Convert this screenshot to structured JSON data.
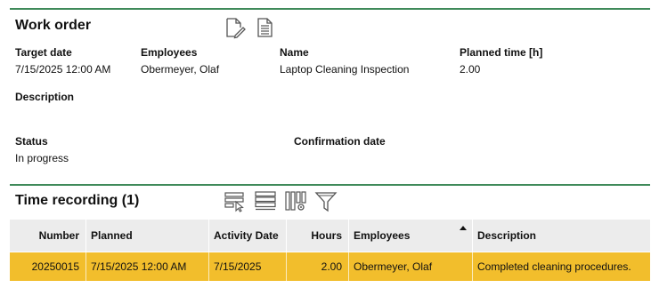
{
  "work_order": {
    "title": "Work order",
    "icons": [
      "edit-document-icon",
      "document-icon"
    ],
    "fields": {
      "target_date": {
        "label": "Target date",
        "value": "7/15/2025 12:00 AM"
      },
      "employees": {
        "label": "Employees",
        "value": "Obermeyer, Olaf"
      },
      "name": {
        "label": "Name",
        "value": "Laptop Cleaning Inspection"
      },
      "planned_time": {
        "label": "Planned time [h]",
        "value": "2.00"
      },
      "description": {
        "label": "Description",
        "value": ""
      },
      "status": {
        "label": "Status",
        "value": "In progress"
      },
      "confirmation_date": {
        "label": "Confirmation date",
        "value": ""
      }
    }
  },
  "time_recording": {
    "title": "Time recording (1)",
    "icons": [
      "select-rows-icon",
      "list-view-icon",
      "column-settings-icon",
      "filter-icon"
    ],
    "columns": {
      "number": "Number",
      "planned": "Planned",
      "activity_date": "Activity Date",
      "hours": "Hours",
      "employees": "Employees",
      "description": "Description"
    },
    "sort": {
      "column": "employees",
      "direction": "ascending"
    },
    "rows": [
      {
        "number": "20250015",
        "planned": "7/15/2025 12:00 AM",
        "activity_date": "7/15/2025",
        "hours": "2.00",
        "employees": "Obermeyer, Olaf",
        "description": "Completed cleaning procedures.",
        "selected": true
      }
    ]
  },
  "colors": {
    "accent_line": "#3f8a5a",
    "header_bg": "#ececec",
    "selected_row": "#f2be2c",
    "icon_stroke": "#555555"
  }
}
